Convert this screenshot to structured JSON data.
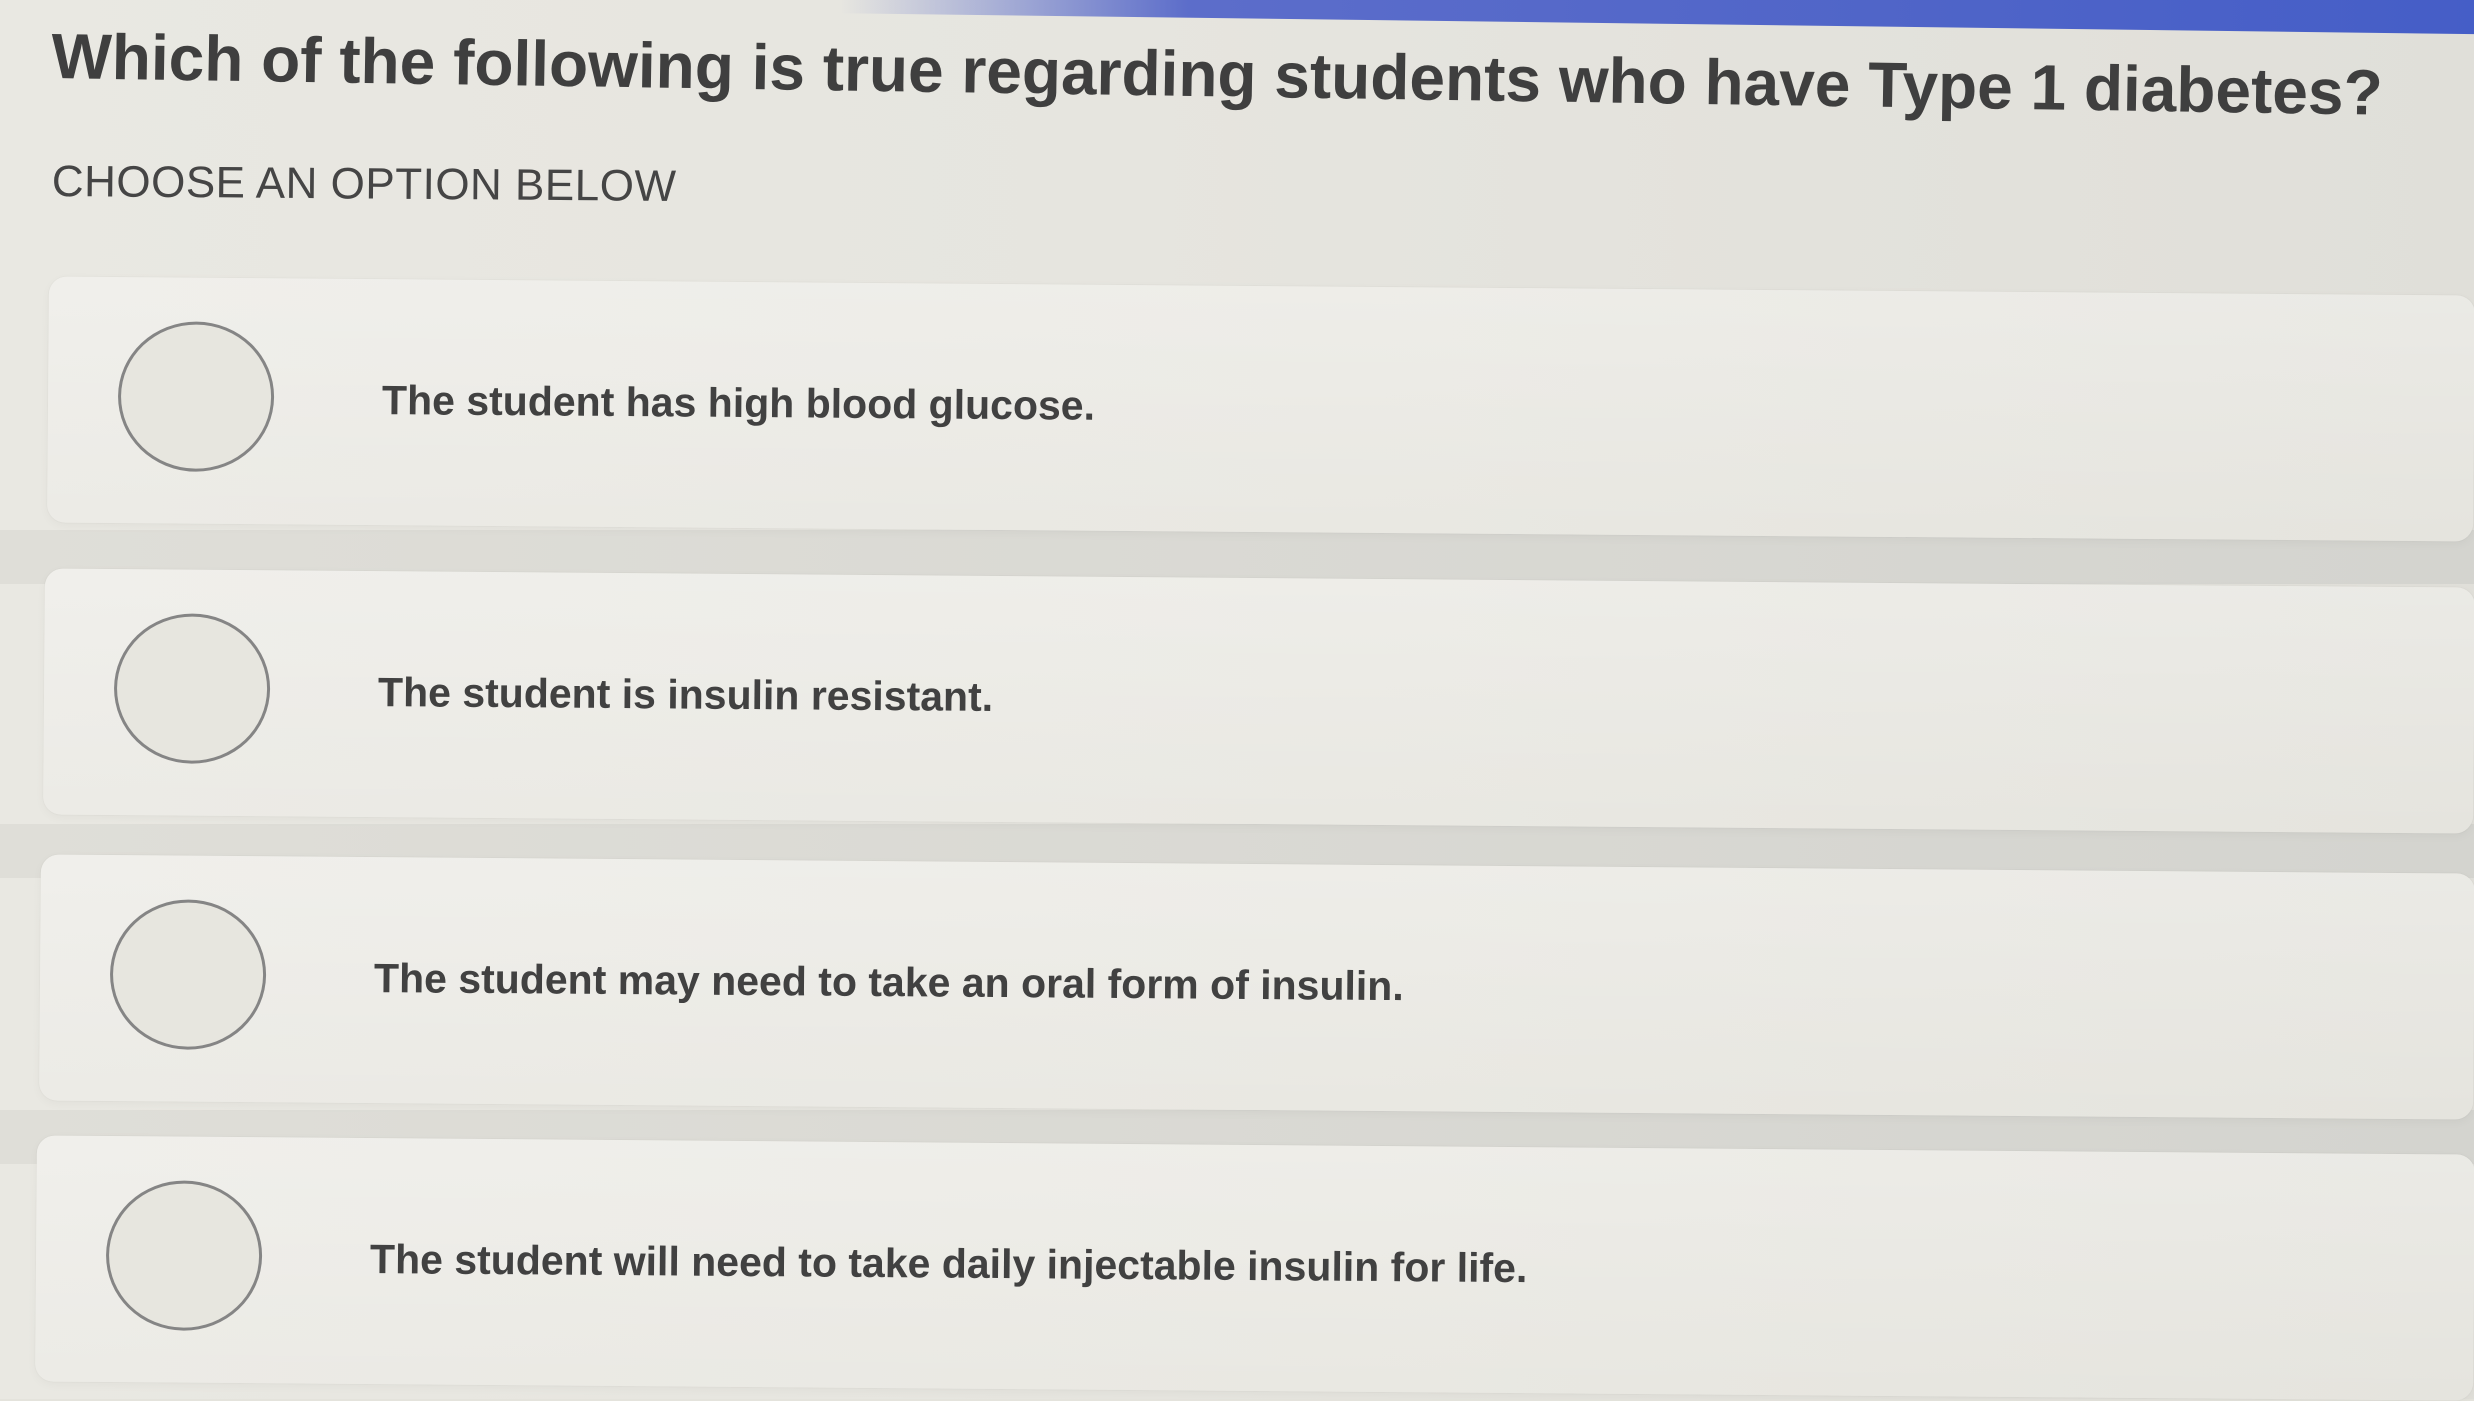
{
  "question": {
    "title": "Which of the following is true regarding students who have Type 1 diabetes?",
    "instruction": "CHOOSE AN OPTION BELOW"
  },
  "options": [
    {
      "label": "The student has high blood glucose.",
      "selected": false
    },
    {
      "label": "The student is insulin resistant.",
      "selected": false
    },
    {
      "label": "The student may need to take an oral form of insulin.",
      "selected": false
    },
    {
      "label": "The student will need to take daily injectable insulin for life.",
      "selected": false
    }
  ],
  "colors": {
    "background": "#e4e3dc",
    "card": "#ebeae4",
    "text": "#414141",
    "radio_border": "#858585",
    "accent": "#3d57c6"
  }
}
